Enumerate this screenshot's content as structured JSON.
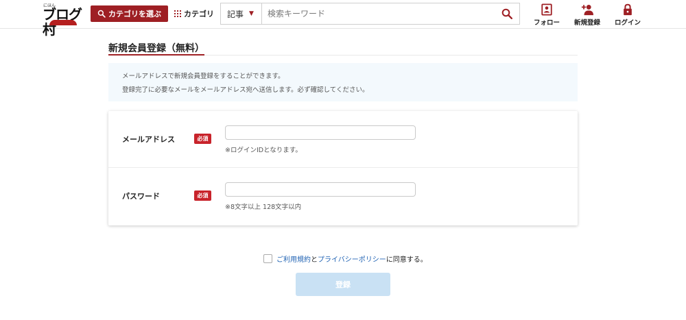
{
  "header": {
    "logo_small": "にほん",
    "logo_main": "ブログ村",
    "category_select_label": "カテゴリを選ぶ",
    "category_label": "カテゴリ",
    "search": {
      "type_value": "記事",
      "placeholder": "検索キーワード"
    },
    "nav": {
      "follow": "フォロー",
      "register": "新規登録",
      "login": "ログイン"
    }
  },
  "page": {
    "title": "新規会員登録（無料）",
    "info_lines": [
      "メールアドレスで新規会員登録をすることができます。",
      "登録完了に必要なメールをメールアドレス宛へ送信します。必ず確認してください。"
    ]
  },
  "form": {
    "email": {
      "label": "メールアドレス",
      "required": "必須",
      "value": "",
      "note": "※ログインIDとなります。"
    },
    "password": {
      "label": "パスワード",
      "required": "必須",
      "value": "",
      "note": "※8文字以上 128文字以内"
    }
  },
  "agreement": {
    "terms_link": "ご利用規約",
    "and": "と",
    "privacy_link": "プライバシーポリシー",
    "suffix": "に同意する。"
  },
  "submit_label": "登録",
  "colors": {
    "brand": "#9e1f24",
    "required_badge": "#c8232b",
    "link": "#1f62b3",
    "submit_disabled": "#c9e1f4",
    "info_bg": "#f3f9fd"
  }
}
